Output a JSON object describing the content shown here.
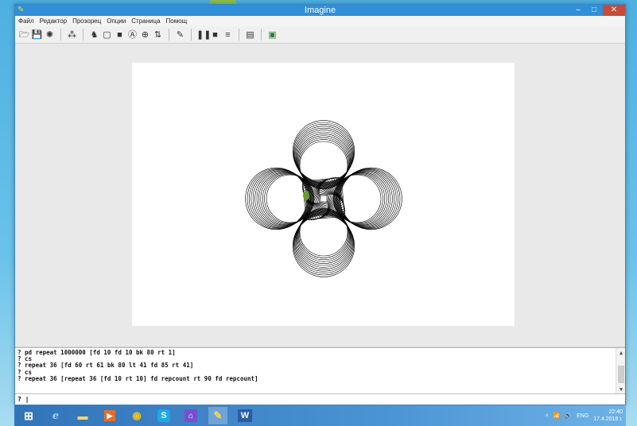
{
  "window": {
    "title": "Imagine",
    "controls": {
      "minimize": "–",
      "maximize": "□",
      "close": "✕"
    }
  },
  "menu": [
    "Файл",
    "Редактор",
    "Прозорец",
    "Опции",
    "Страница",
    "Помощ"
  ],
  "console": {
    "lines": [
      "? pd repeat 1000000 [fd 10 fd 10 bk 80 rt 1]",
      "? cs",
      "? repeat 36 [fd 60 rt 61 bk 80 lt 41 fd 85 rt 41]",
      "? cs",
      "? repeat 36 [repeat 36 [fd 10 rt 10] fd repcount rt 90 fd repcount]"
    ],
    "input_value": "? |"
  },
  "taskbar": {
    "apps": [
      "start-icon",
      "internet-explorer-icon",
      "file-explorer-icon",
      "media-player-icon",
      "chrome-icon",
      "skype-icon",
      "twitch-icon",
      "imagine-icon",
      "word-icon"
    ],
    "tray": {
      "language": "ENG",
      "time": "22:40",
      "date": "17.4.2018 г."
    }
  },
  "colors": {
    "titlebar": "#2f8fd8",
    "close_button": "#c74b3a",
    "taskbar": "#3274b8",
    "drawing_stroke": "#000000",
    "turtle": "#6b9a2f"
  }
}
